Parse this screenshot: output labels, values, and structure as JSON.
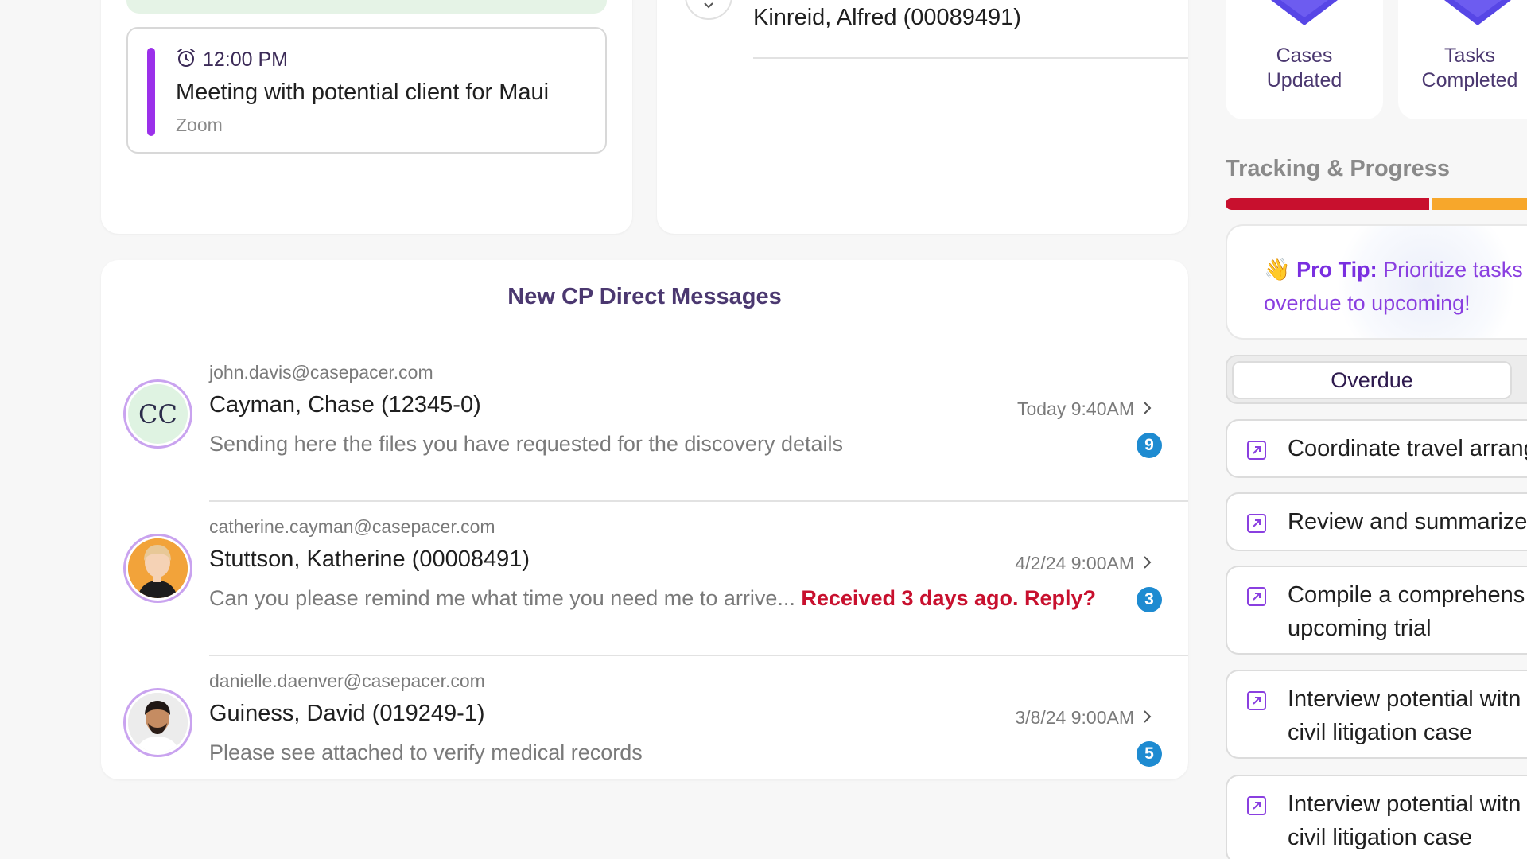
{
  "schedule": {
    "time": "12:00 PM",
    "title": "Meeting with potential client for Maui",
    "location": "Zoom"
  },
  "contact": {
    "name": "Kinreid, Alfred (00089491)"
  },
  "messages": {
    "title": "New CP Direct Messages",
    "items": [
      {
        "email": "john.davis@casepacer.com",
        "name": "Cayman, Chase (12345-0)",
        "preview": "Sending here the files you have requested for the discovery details",
        "alert": "",
        "date": "Today 9:40AM",
        "badge": "9",
        "initials": "CC"
      },
      {
        "email": "catherine.cayman@casepacer.com",
        "name": "Stuttson, Katherine (00008491)",
        "preview": "Can you please remind me what time you need me to arrive...",
        "alert": "Received 3 days ago. Reply?",
        "date": "4/2/24 9:00AM",
        "badge": "3",
        "initials": ""
      },
      {
        "email": "danielle.daenver@casepacer.com",
        "name": "Guiness, David (019249-1)",
        "preview": "Please see attached to verify medical records",
        "alert": "",
        "date": "3/8/24 9:00AM",
        "badge": "5",
        "initials": ""
      }
    ]
  },
  "stats": {
    "cases_line1": "Cases",
    "cases_line2": "Updated",
    "tasks_line1": "Tasks",
    "tasks_line2": "Completed"
  },
  "tracking": {
    "title": "Tracking & Progress",
    "tip_label": "Pro Tip:",
    "tip_text": "Prioritize tasks overdue to upcoming!",
    "tip_emoji": "👋",
    "segment_label": "Overdue"
  },
  "tasks": [
    {
      "line1": "Coordinate travel arrang",
      "line2": ""
    },
    {
      "line1": "Review and summarize",
      "line2": ""
    },
    {
      "line1": "Compile a comprehens",
      "line2": "upcoming trial"
    },
    {
      "line1": "Interview potential witn",
      "line2": "civil litigation case"
    },
    {
      "line1": "Interview potential witn",
      "line2": "civil litigation case"
    }
  ],
  "colors": {
    "accent_purple": "#9b30ea",
    "alert_red": "#c8102e",
    "badge_blue": "#1e8bd1",
    "progress_orange": "#f7a72b"
  }
}
